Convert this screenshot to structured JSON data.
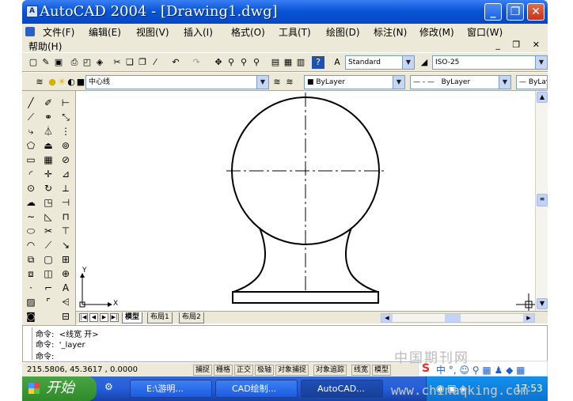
{
  "window": {
    "title": "AutoCAD 2004 - [Drawing1.dwg]",
    "app_icon": "A"
  },
  "menu": [
    "文件(F)",
    "编辑(E)",
    "视图(V)",
    "插入(I)",
    "格式(O)",
    "工具(T)",
    "绘图(D)",
    "标注(N)",
    "修改(M)",
    "窗口(W)",
    "帮助(H)"
  ],
  "toolbar": {
    "text_style": "Standard",
    "dim_style": "ISO-25",
    "layer": "中心线",
    "color": "ByLayer",
    "linetype": "ByLayer",
    "lineweight": "ByLaye"
  },
  "tabs": {
    "model": "模型",
    "layout1": "布局1",
    "layout2": "布局2"
  },
  "ucs": {
    "x_label": "X",
    "y_label": "Y"
  },
  "command": {
    "line1": "命令:  <线宽 开>",
    "line2": "命令:  '_layer",
    "line3": "命令:"
  },
  "status": {
    "coords": "215.5806,  45.3617 , 0.0000",
    "buttons": [
      "捕捉",
      "栅格",
      "正交",
      "极轴",
      "对象捕捉",
      "对象追踪",
      "线宽",
      "模型"
    ]
  },
  "taskbar": {
    "start": "开始",
    "tasks": [
      "E:\\游明...",
      "CAD绘制...",
      "AutoCAD..."
    ],
    "clock": "17:53"
  },
  "watermark": {
    "cn": "中国期刊网",
    "url": "www.chinaqking.com"
  },
  "colors": {
    "titlebar": "#0a55d8",
    "chrome": "#ece9d8",
    "taskbar": "#245edc",
    "start": "#3a9a34"
  }
}
